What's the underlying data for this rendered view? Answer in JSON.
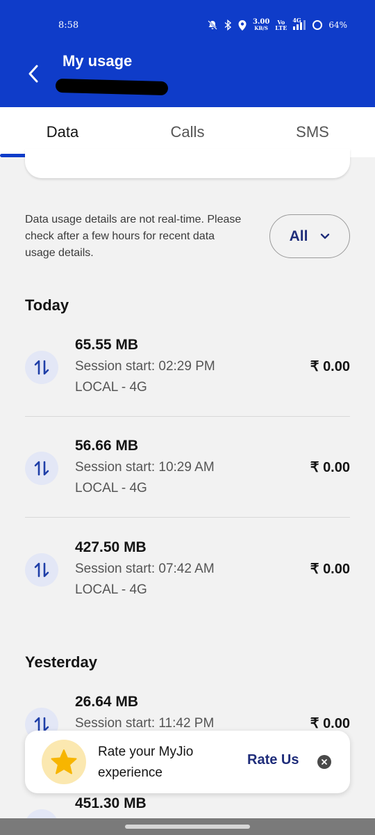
{
  "status_bar": {
    "time": "8:58",
    "net_speed_value": "3.00",
    "net_speed_unit": "KB/S",
    "volte_top": "Vo",
    "volte_bottom": "LTE",
    "network_type": "4G",
    "battery": "64%",
    "icons": [
      "mute-bell-icon",
      "bluetooth-icon",
      "location-icon",
      "signal-icon",
      "battery-ring-icon"
    ]
  },
  "header": {
    "title": "My usage",
    "back_icon": "chevron-left-icon",
    "accent_color": "#0f3cc9"
  },
  "tabs": [
    {
      "label": "Data",
      "active": true
    },
    {
      "label": "Calls",
      "active": false
    },
    {
      "label": "SMS",
      "active": false
    }
  ],
  "notice": "Data usage details are not real-time. Please check after a few hours for recent data usage details.",
  "filter": {
    "selected": "All",
    "icon": "chevron-down-icon"
  },
  "sections": [
    {
      "heading": "Today",
      "items": [
        {
          "amount": "65.55 MB",
          "session": "Session start: 02:29 PM",
          "network": "LOCAL - 4G",
          "cost": "₹ 0.00"
        },
        {
          "amount": "56.66 MB",
          "session": "Session start: 10:29 AM",
          "network": "LOCAL - 4G",
          "cost": "₹ 0.00"
        },
        {
          "amount": "427.50 MB",
          "session": "Session start: 07:42 AM",
          "network": "LOCAL - 4G",
          "cost": "₹ 0.00"
        }
      ]
    },
    {
      "heading": "Yesterday",
      "items": [
        {
          "amount": "26.64 MB",
          "session": "Session start: 11:42 PM",
          "cost": "₹ 0.00"
        },
        {
          "amount": "451.30 MB"
        }
      ]
    }
  ],
  "rate_prompt": {
    "line1": "Rate your MyJio",
    "line2": "experience",
    "button": "Rate Us",
    "icon": "star-icon",
    "close_icon": "close-icon"
  }
}
